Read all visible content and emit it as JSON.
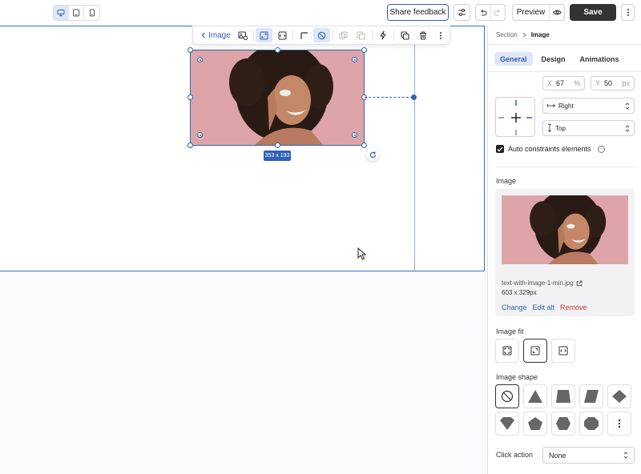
{
  "topbar": {
    "device_icons": [
      "desktop-icon",
      "tablet-icon",
      "mobile-icon"
    ],
    "share_feedback_label": "Share feedback",
    "preview_label": "Preview",
    "save_label": "Save"
  },
  "element_toolbar": {
    "back_label": "Image",
    "tools": [
      "replace-image-icon",
      "crop-fill-icon",
      "fit-width-icon",
      "corner-radius-icon",
      "no-shape-icon",
      "duplicate-icon",
      "layers-icon",
      "interaction-icon",
      "copy-icon",
      "delete-icon",
      "more-icon"
    ]
  },
  "canvas": {
    "size_label": "353 x 193"
  },
  "panel": {
    "breadcrumb": {
      "section": "Section",
      "current": "Image"
    },
    "tabs": [
      {
        "label": "General",
        "active": true
      },
      {
        "label": "Design",
        "active": false
      },
      {
        "label": "Animations",
        "active": false
      }
    ],
    "position": {
      "x_key": "X",
      "x_value": "67",
      "x_unit": "%",
      "y_key": "Y",
      "y_value": "50",
      "y_unit": "px"
    },
    "horizontal_constraint": "Right",
    "vertical_constraint": "Top",
    "auto_constraints_label": "Auto constraints elements",
    "auto_constraints_checked": true,
    "image_heading": "Image",
    "image": {
      "filename": "text-with-image-1-min.jpg",
      "dimensions": "603 x 329px",
      "change_label": "Change",
      "edit_alt_label": "Edit alt",
      "remove_label": "Remove"
    },
    "image_fit_heading": "Image fit",
    "image_fit_options": [
      "fit-contain-icon",
      "fit-cover-icon",
      "fit-width-icon"
    ],
    "image_fit_selected": 1,
    "image_shape_heading": "Image shape",
    "image_shapes": [
      "no-shape-icon",
      "triangle-icon",
      "trapezoid-icon",
      "parallelogram-icon",
      "diamond-icon",
      "pentagon-down-icon",
      "pentagon-icon",
      "hexagon-icon",
      "octagon-icon",
      "more-shapes-icon"
    ],
    "image_shape_selected": 0,
    "click_action_label": "Click action",
    "click_action_value": "None"
  },
  "colors": {
    "accent": "#2f62b8",
    "image_background": "#dea5a9",
    "save_button": "#333333",
    "remove_link": "#c0392b"
  }
}
